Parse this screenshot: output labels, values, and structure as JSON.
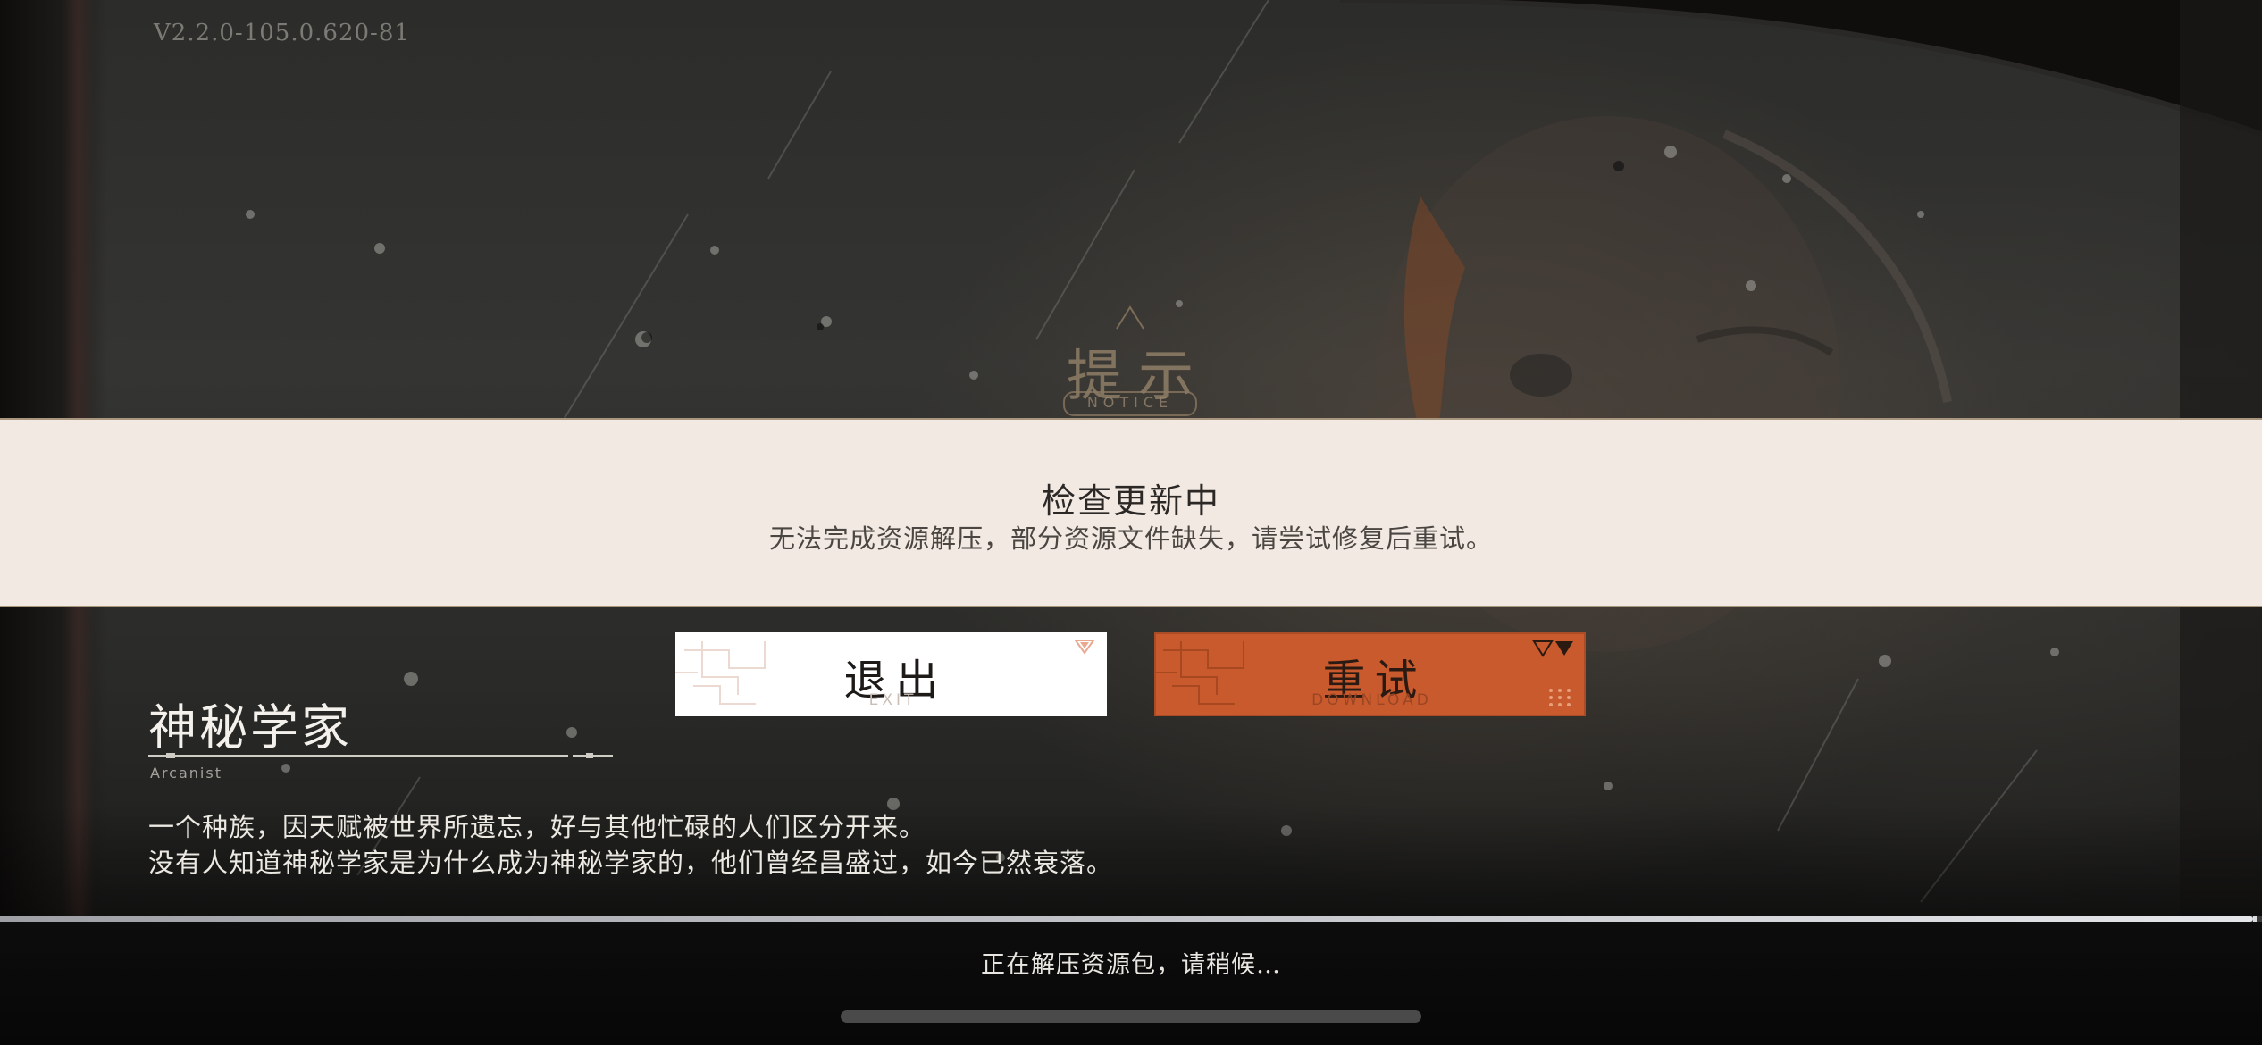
{
  "version": "V2.2.0-105.0.620-81",
  "notice": {
    "title": "提示",
    "title_en": "NOTICE",
    "heading": "检查更新中",
    "message": "无法完成资源解压，部分资源文件缺失，请尝试修复后重试。"
  },
  "buttons": {
    "exit": {
      "label": "退出",
      "sub": "EXIT"
    },
    "retry": {
      "label": "重试",
      "sub": "DOWNLOAD"
    }
  },
  "class_info": {
    "name": "神秘学家",
    "name_en": "Arcanist",
    "desc_line1": "一个种族，因天赋被世界所遗忘，好与其他忙碌的人们区分开来。",
    "desc_line2": "没有人知道神秘学家是为什么成为神秘学家的，他们曾经昌盛过，如今已然衰落。"
  },
  "progress": {
    "percent": 99.6
  },
  "status_text": "正在解压资源包，请稍候…",
  "colors": {
    "accent": "#c85a2d",
    "notice_bg": "#f2e9e3",
    "notice_border": "#a8967e"
  }
}
